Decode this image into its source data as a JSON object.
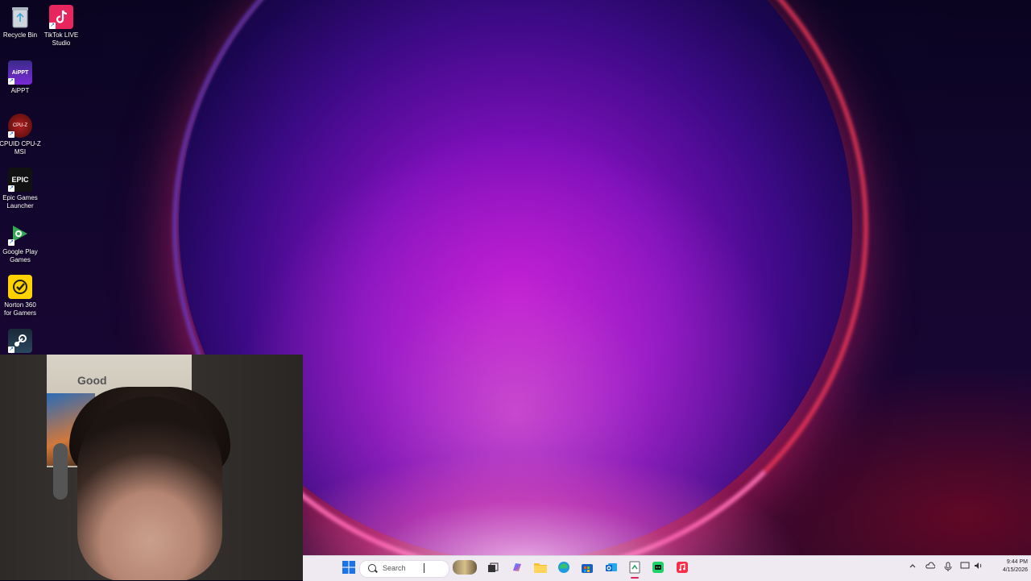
{
  "desktop": {
    "icons": [
      {
        "label": "Recycle Bin",
        "icon": "recycle-bin-icon"
      },
      {
        "label": "TikTok LIVE\nStudio",
        "icon": "tiktok-icon"
      },
      {
        "label": "AiPPT",
        "icon": "aippt-icon",
        "logo_text": "AiPPT"
      },
      {
        "label": "CPUID CPU-Z\nMSI",
        "icon": "cpuz-icon"
      },
      {
        "label": "Epic Games\nLauncher",
        "icon": "epic-games-icon",
        "logo_text": "EPIC"
      },
      {
        "label": "Google Play\nGames",
        "icon": "google-play-games-icon"
      },
      {
        "label": "Norton 360\nfor Gamers",
        "icon": "norton-icon"
      },
      {
        "label": "",
        "icon": "steam-icon"
      }
    ]
  },
  "webcam": {
    "poster_text": "Good"
  },
  "taskbar": {
    "search_placeholder": "Search",
    "apps": [
      {
        "icon": "windows-start-icon"
      },
      {
        "icon": "widgets-news-icon"
      },
      {
        "icon": "task-view-icon"
      },
      {
        "icon": "copilot-icon"
      },
      {
        "icon": "file-explorer-icon"
      },
      {
        "icon": "edge-icon"
      },
      {
        "icon": "microsoft-store-icon"
      },
      {
        "icon": "outlook-icon"
      },
      {
        "icon": "notepad-icon",
        "active": true
      },
      {
        "icon": "green-app-icon"
      },
      {
        "icon": "apple-music-icon"
      }
    ],
    "tray": {
      "icons": [
        "chevron-up-icon",
        "onedrive-icon",
        "microphone-icon",
        "display-icon",
        "volume-icon"
      ],
      "time": "9:44 PM",
      "date": "4/15/2026"
    }
  },
  "colors": {
    "taskbar_bg": "#efeaf2",
    "accent": "#e0245e"
  }
}
